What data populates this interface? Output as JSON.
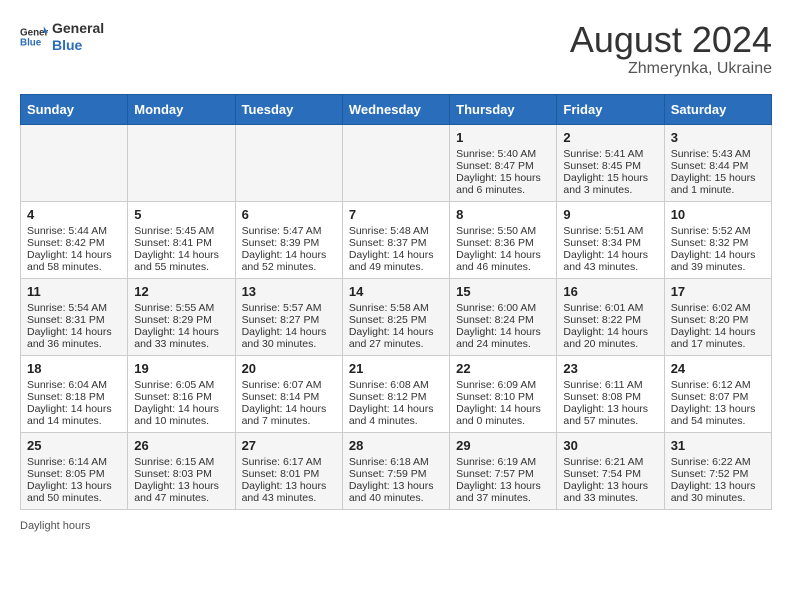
{
  "header": {
    "logo_general": "General",
    "logo_blue": "Blue",
    "title": "August 2024",
    "subtitle": "Zhmerynka, Ukraine"
  },
  "calendar": {
    "days_of_week": [
      "Sunday",
      "Monday",
      "Tuesday",
      "Wednesday",
      "Thursday",
      "Friday",
      "Saturday"
    ],
    "weeks": [
      [
        {
          "day": "",
          "sunrise": "",
          "sunset": "",
          "daylight": ""
        },
        {
          "day": "",
          "sunrise": "",
          "sunset": "",
          "daylight": ""
        },
        {
          "day": "",
          "sunrise": "",
          "sunset": "",
          "daylight": ""
        },
        {
          "day": "",
          "sunrise": "",
          "sunset": "",
          "daylight": ""
        },
        {
          "day": "1",
          "sunrise": "Sunrise: 5:40 AM",
          "sunset": "Sunset: 8:47 PM",
          "daylight": "Daylight: 15 hours and 6 minutes."
        },
        {
          "day": "2",
          "sunrise": "Sunrise: 5:41 AM",
          "sunset": "Sunset: 8:45 PM",
          "daylight": "Daylight: 15 hours and 3 minutes."
        },
        {
          "day": "3",
          "sunrise": "Sunrise: 5:43 AM",
          "sunset": "Sunset: 8:44 PM",
          "daylight": "Daylight: 15 hours and 1 minute."
        }
      ],
      [
        {
          "day": "4",
          "sunrise": "Sunrise: 5:44 AM",
          "sunset": "Sunset: 8:42 PM",
          "daylight": "Daylight: 14 hours and 58 minutes."
        },
        {
          "day": "5",
          "sunrise": "Sunrise: 5:45 AM",
          "sunset": "Sunset: 8:41 PM",
          "daylight": "Daylight: 14 hours and 55 minutes."
        },
        {
          "day": "6",
          "sunrise": "Sunrise: 5:47 AM",
          "sunset": "Sunset: 8:39 PM",
          "daylight": "Daylight: 14 hours and 52 minutes."
        },
        {
          "day": "7",
          "sunrise": "Sunrise: 5:48 AM",
          "sunset": "Sunset: 8:37 PM",
          "daylight": "Daylight: 14 hours and 49 minutes."
        },
        {
          "day": "8",
          "sunrise": "Sunrise: 5:50 AM",
          "sunset": "Sunset: 8:36 PM",
          "daylight": "Daylight: 14 hours and 46 minutes."
        },
        {
          "day": "9",
          "sunrise": "Sunrise: 5:51 AM",
          "sunset": "Sunset: 8:34 PM",
          "daylight": "Daylight: 14 hours and 43 minutes."
        },
        {
          "day": "10",
          "sunrise": "Sunrise: 5:52 AM",
          "sunset": "Sunset: 8:32 PM",
          "daylight": "Daylight: 14 hours and 39 minutes."
        }
      ],
      [
        {
          "day": "11",
          "sunrise": "Sunrise: 5:54 AM",
          "sunset": "Sunset: 8:31 PM",
          "daylight": "Daylight: 14 hours and 36 minutes."
        },
        {
          "day": "12",
          "sunrise": "Sunrise: 5:55 AM",
          "sunset": "Sunset: 8:29 PM",
          "daylight": "Daylight: 14 hours and 33 minutes."
        },
        {
          "day": "13",
          "sunrise": "Sunrise: 5:57 AM",
          "sunset": "Sunset: 8:27 PM",
          "daylight": "Daylight: 14 hours and 30 minutes."
        },
        {
          "day": "14",
          "sunrise": "Sunrise: 5:58 AM",
          "sunset": "Sunset: 8:25 PM",
          "daylight": "Daylight: 14 hours and 27 minutes."
        },
        {
          "day": "15",
          "sunrise": "Sunrise: 6:00 AM",
          "sunset": "Sunset: 8:24 PM",
          "daylight": "Daylight: 14 hours and 24 minutes."
        },
        {
          "day": "16",
          "sunrise": "Sunrise: 6:01 AM",
          "sunset": "Sunset: 8:22 PM",
          "daylight": "Daylight: 14 hours and 20 minutes."
        },
        {
          "day": "17",
          "sunrise": "Sunrise: 6:02 AM",
          "sunset": "Sunset: 8:20 PM",
          "daylight": "Daylight: 14 hours and 17 minutes."
        }
      ],
      [
        {
          "day": "18",
          "sunrise": "Sunrise: 6:04 AM",
          "sunset": "Sunset: 8:18 PM",
          "daylight": "Daylight: 14 hours and 14 minutes."
        },
        {
          "day": "19",
          "sunrise": "Sunrise: 6:05 AM",
          "sunset": "Sunset: 8:16 PM",
          "daylight": "Daylight: 14 hours and 10 minutes."
        },
        {
          "day": "20",
          "sunrise": "Sunrise: 6:07 AM",
          "sunset": "Sunset: 8:14 PM",
          "daylight": "Daylight: 14 hours and 7 minutes."
        },
        {
          "day": "21",
          "sunrise": "Sunrise: 6:08 AM",
          "sunset": "Sunset: 8:12 PM",
          "daylight": "Daylight: 14 hours and 4 minutes."
        },
        {
          "day": "22",
          "sunrise": "Sunrise: 6:09 AM",
          "sunset": "Sunset: 8:10 PM",
          "daylight": "Daylight: 14 hours and 0 minutes."
        },
        {
          "day": "23",
          "sunrise": "Sunrise: 6:11 AM",
          "sunset": "Sunset: 8:08 PM",
          "daylight": "Daylight: 13 hours and 57 minutes."
        },
        {
          "day": "24",
          "sunrise": "Sunrise: 6:12 AM",
          "sunset": "Sunset: 8:07 PM",
          "daylight": "Daylight: 13 hours and 54 minutes."
        }
      ],
      [
        {
          "day": "25",
          "sunrise": "Sunrise: 6:14 AM",
          "sunset": "Sunset: 8:05 PM",
          "daylight": "Daylight: 13 hours and 50 minutes."
        },
        {
          "day": "26",
          "sunrise": "Sunrise: 6:15 AM",
          "sunset": "Sunset: 8:03 PM",
          "daylight": "Daylight: 13 hours and 47 minutes."
        },
        {
          "day": "27",
          "sunrise": "Sunrise: 6:17 AM",
          "sunset": "Sunset: 8:01 PM",
          "daylight": "Daylight: 13 hours and 43 minutes."
        },
        {
          "day": "28",
          "sunrise": "Sunrise: 6:18 AM",
          "sunset": "Sunset: 7:59 PM",
          "daylight": "Daylight: 13 hours and 40 minutes."
        },
        {
          "day": "29",
          "sunrise": "Sunrise: 6:19 AM",
          "sunset": "Sunset: 7:57 PM",
          "daylight": "Daylight: 13 hours and 37 minutes."
        },
        {
          "day": "30",
          "sunrise": "Sunrise: 6:21 AM",
          "sunset": "Sunset: 7:54 PM",
          "daylight": "Daylight: 13 hours and 33 minutes."
        },
        {
          "day": "31",
          "sunrise": "Sunrise: 6:22 AM",
          "sunset": "Sunset: 7:52 PM",
          "daylight": "Daylight: 13 hours and 30 minutes."
        }
      ]
    ]
  },
  "footer": {
    "text": "Daylight hours"
  }
}
